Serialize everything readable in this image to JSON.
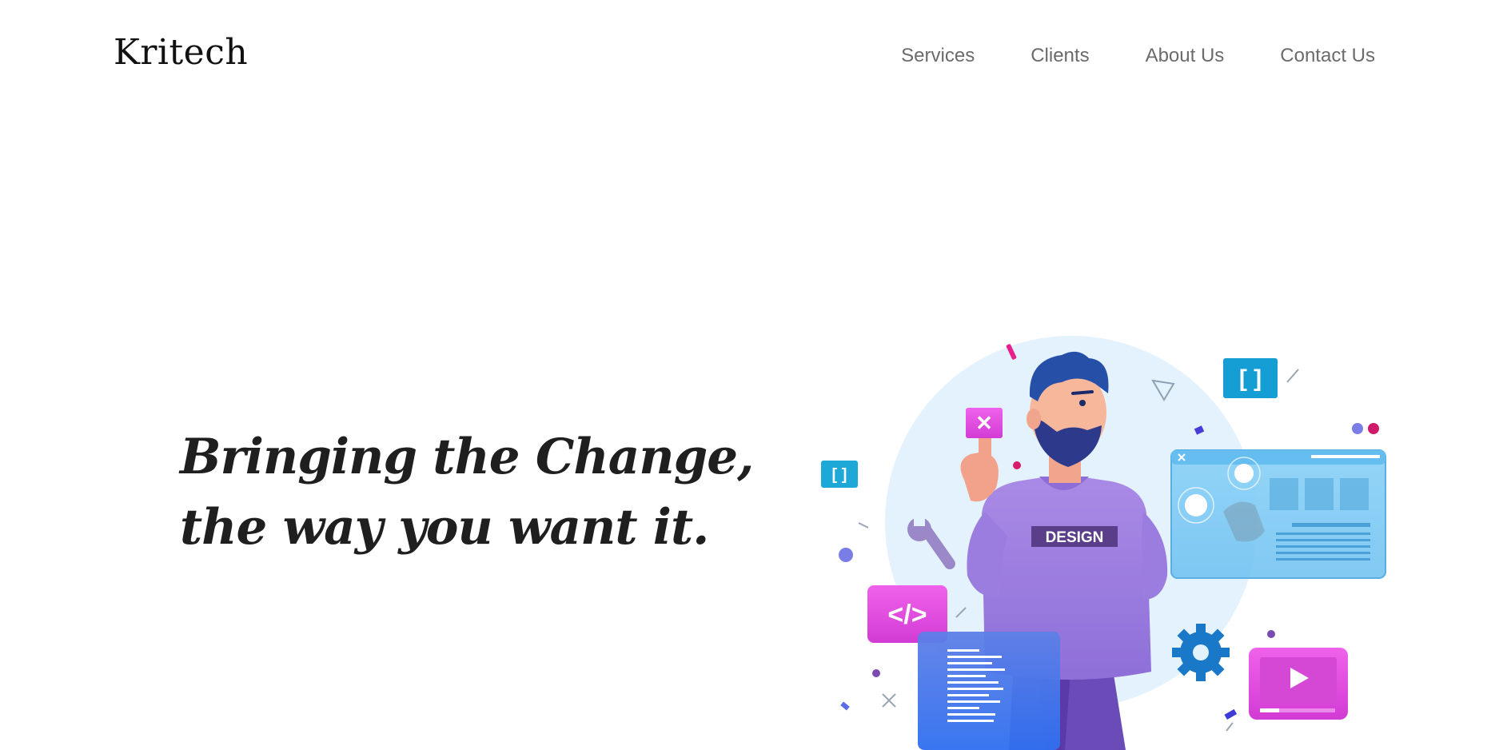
{
  "header": {
    "logo": "Kritech",
    "nav": [
      {
        "label": "Services"
      },
      {
        "label": "Clients"
      },
      {
        "label": "About Us"
      },
      {
        "label": "Contact Us"
      }
    ]
  },
  "hero": {
    "heading_line1": "Bringing the Change,",
    "heading_line2": "the way you want it.",
    "illustration": {
      "shirt_label": "DESIGN",
      "code_badge": "</>",
      "bracket_badge": "[ ]",
      "small_bracket_badge": "[ ]",
      "x_badge": "✕"
    }
  },
  "colors": {
    "text_dark": "#1f1f1f",
    "nav_gray": "#6b6b6b",
    "pink": "#e33fd6",
    "blue": "#3a78e8",
    "cyan": "#1aa3d6",
    "purple": "#9a7bdd",
    "light_blue_circle": "#e3f2fc"
  }
}
